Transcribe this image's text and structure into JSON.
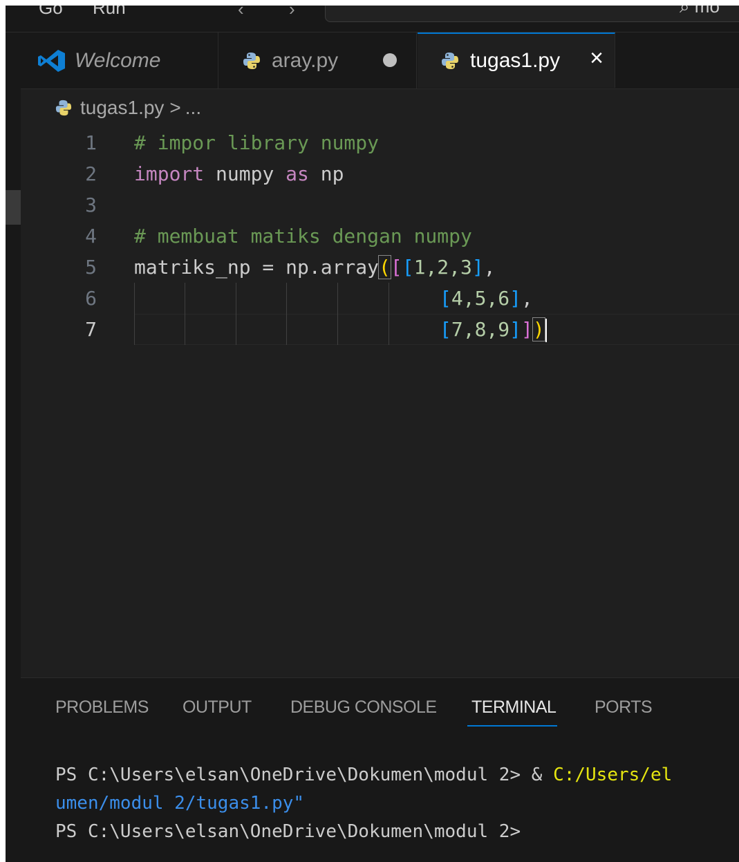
{
  "menubar": {
    "items": [
      "Go",
      "Run"
    ],
    "back_arrow": "‹",
    "forward_arrow": "›",
    "command_center_text": "⌕ mo"
  },
  "tabs": [
    {
      "label": "Welcome",
      "icon": "vscode-logo-icon",
      "italic": true
    },
    {
      "label": "aray.py",
      "icon": "python-file-icon",
      "dirty": true
    },
    {
      "label": "tugas1.py",
      "icon": "python-file-icon",
      "active": true,
      "close": "×"
    }
  ],
  "breadcrumb": {
    "file": "tugas1.py",
    "separator": ">",
    "rest": "..."
  },
  "editor": {
    "line_numbers": [
      "1",
      "2",
      "3",
      "4",
      "5",
      "6",
      "7"
    ],
    "current_line": 7,
    "lines": {
      "l1_comment": "# impor library numpy",
      "l2_import": "import",
      "l2_mod": " numpy ",
      "l2_as": "as",
      "l2_alias": " np",
      "l4_comment": "# membuat matiks dengan numpy",
      "l5_prefix": "matriks_np = np.array",
      "l5_paren": "(",
      "l5_br2": "[",
      "l5_br3": "[",
      "l5_nums": "1,2,3",
      "l5_close3": "]",
      "l5_comma": ",",
      "l6_open": "[",
      "l6_nums": "4,5,6",
      "l6_close": "]",
      "l6_comma": ",",
      "l7_open": "[",
      "l7_nums": "7,8,9",
      "l7_close3": "]",
      "l7_close2": "]",
      "l7_paren": ")"
    }
  },
  "panel": {
    "tabs": [
      "PROBLEMS",
      "OUTPUT",
      "DEBUG CONSOLE",
      "TERMINAL",
      "PORTS"
    ],
    "active_tab": "TERMINAL"
  },
  "terminal": {
    "line1_prompt": "PS C:\\Users\\elsan\\OneDrive\\Dokumen\\modul 2> & ",
    "line1_cmd": "C:/Users/el",
    "line2": "umen/modul 2/tugas1.py\"",
    "line3": "PS C:\\Users\\elsan\\OneDrive\\Dokumen\\modul 2>"
  },
  "colors": {
    "accent": "#0078d4",
    "comment": "#6a9955",
    "keyword": "#c586c0",
    "bracket_1": "#ffd700",
    "bracket_2": "#da70d6",
    "bracket_3": "#179fff"
  }
}
